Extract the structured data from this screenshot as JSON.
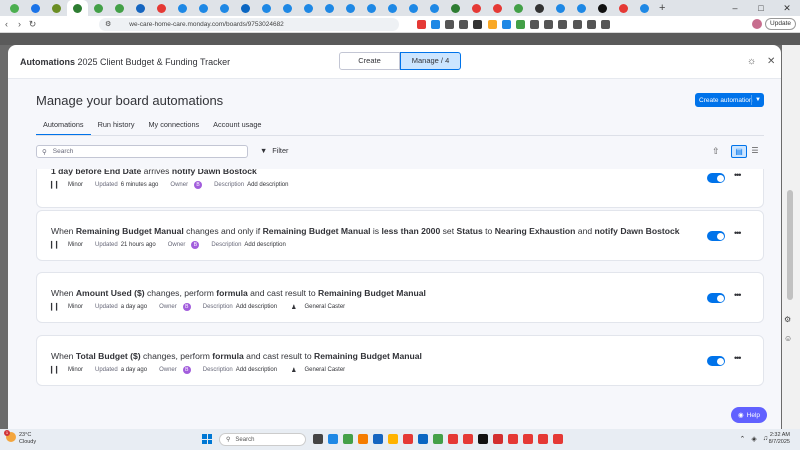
{
  "browser": {
    "url": "we-care-home-care.monday.com/boards/9753024682",
    "update_label": "Update",
    "tab_colors": [
      "#4caf50",
      "#1a73e8",
      "#6b8e23",
      "#2e7d32",
      "#43a047",
      "#43a047",
      "#1565c0",
      "#e53935",
      "#1e88e5",
      "#1e88e5",
      "#1e88e5",
      "#0a66c2",
      "#1e88e5",
      "#1e88e5",
      "#1e88e5",
      "#1e88e5",
      "#1e88e5",
      "#1e88e5",
      "#1e88e5",
      "#1e88e5",
      "#1e88e5",
      "#2e7d32",
      "#e53935",
      "#e53935",
      "#43a047",
      "#333333",
      "#1e88e5",
      "#1e88e5",
      "#111111",
      "#e53935",
      "#1e88e5"
    ],
    "ext_colors": [
      "#e53935",
      "#1e88e5",
      "#555555",
      "#555555",
      "#333333",
      "#f9a825",
      "#1e88e5",
      "#43a047",
      "#555555",
      "#555555",
      "#555555",
      "#555555",
      "#555555",
      "#555555"
    ]
  },
  "modal": {
    "title_bold": "Automations",
    "title_rest": "2025 Client Budget & Funding Tracker",
    "seg_create": "Create",
    "seg_manage": "Manage / 4",
    "page_title": "Manage your board automations",
    "create_button": "Create automation",
    "tabs": [
      "Automations",
      "Run history",
      "My connections",
      "Account usage"
    ],
    "search_placeholder": "Search",
    "filter_label": "Filter"
  },
  "automations": [
    {
      "segments": [
        {
          "t": "1 day before ",
          "b": true
        },
        {
          "t": "End Date",
          "b": true
        },
        {
          "t": " arrives ",
          "b": false
        },
        {
          "t": "notify Dawn Bostock",
          "b": true
        }
      ],
      "impact_label": "Minor",
      "updated_label": "Updated",
      "updated_value": "6 minutes ago",
      "owner_label": "Owner",
      "owner_initial": "B",
      "description_label": "Description",
      "description_action": "Add description",
      "connection": ""
    },
    {
      "segments": [
        {
          "t": "When ",
          "b": false
        },
        {
          "t": "Remaining Budget Manual",
          "b": true
        },
        {
          "t": " changes and only if ",
          "b": false
        },
        {
          "t": "Remaining Budget Manual",
          "b": true
        },
        {
          "t": " is ",
          "b": false
        },
        {
          "t": "less than 2000",
          "b": true
        },
        {
          "t": " set ",
          "b": false
        },
        {
          "t": "Status",
          "b": true
        },
        {
          "t": " to ",
          "b": false
        },
        {
          "t": "Nearing Exhaustion",
          "b": true
        },
        {
          "t": " and ",
          "b": false
        },
        {
          "t": "notify Dawn Bostock",
          "b": true
        }
      ],
      "impact_label": "Minor",
      "updated_label": "Updated",
      "updated_value": "21 hours ago",
      "owner_label": "Owner",
      "owner_initial": "B",
      "description_label": "Description",
      "description_action": "Add description",
      "connection": ""
    },
    {
      "segments": [
        {
          "t": "When ",
          "b": false
        },
        {
          "t": "Amount Used ($)",
          "b": true
        },
        {
          "t": " changes, perform ",
          "b": false
        },
        {
          "t": "formula",
          "b": true
        },
        {
          "t": " and cast result to ",
          "b": false
        },
        {
          "t": "Remaining Budget Manual",
          "b": true
        }
      ],
      "impact_label": "Minor",
      "updated_label": "Updated",
      "updated_value": "a day ago",
      "owner_label": "Owner",
      "owner_initial": "B",
      "description_label": "Description",
      "description_action": "Add description",
      "connection": "General Caster"
    },
    {
      "segments": [
        {
          "t": "When ",
          "b": false
        },
        {
          "t": "Total Budget ($)",
          "b": true
        },
        {
          "t": " changes, perform ",
          "b": false
        },
        {
          "t": "formula",
          "b": true
        },
        {
          "t": " and cast result to ",
          "b": false
        },
        {
          "t": "Remaining Budget Manual",
          "b": true
        }
      ],
      "impact_label": "Minor",
      "updated_label": "Updated",
      "updated_value": "a day ago",
      "owner_label": "Owner",
      "owner_initial": "B",
      "description_label": "Description",
      "description_action": "Add description",
      "connection": "General Caster"
    }
  ],
  "help_label": "Help",
  "taskbar": {
    "weather_temp": "23°C",
    "weather_desc": "Cloudy",
    "weather_badge": "1",
    "search_placeholder": "Search",
    "time": "2:32 AM",
    "date": "8/7/2025",
    "app_colors": [
      "#444444",
      "#1e88e5",
      "#43a047",
      "#f57c00",
      "#1565c0",
      "#ffb300",
      "#e53935",
      "#0a66c2",
      "#43a047",
      "#e53935",
      "#e53935",
      "#111111",
      "#d32f2f",
      "#e53935",
      "#e53935",
      "#e53935",
      "#e53935"
    ]
  }
}
